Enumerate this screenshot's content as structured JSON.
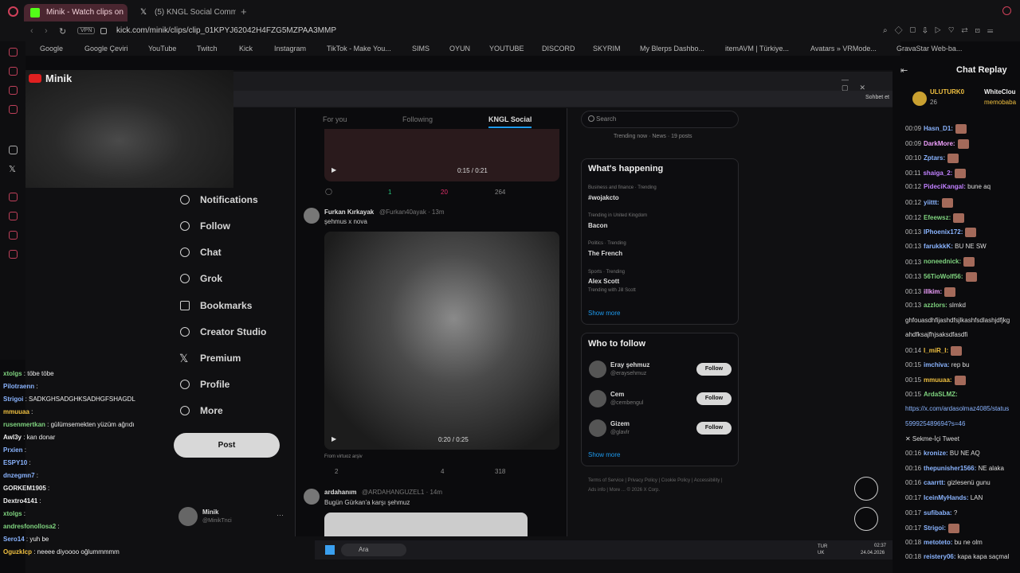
{
  "browser": {
    "tabs": [
      {
        "label": "Minik - Watch clips on"
      },
      {
        "label": "(5) KNGL Social Commun"
      }
    ],
    "vpn": "VPN",
    "url": "kick.com/minik/clips/clip_01KPYJ62042H4FZG5MZPAA3MMP",
    "bookmarks": [
      "Google",
      "Google Çeviri",
      "YouTube",
      "Twitch",
      "Kick",
      "Instagram",
      "TikTok - Make You...",
      "SIMS",
      "OYUN",
      "YOUTUBE",
      "DISCORD",
      "SKYRIM",
      "My Blerps Dashbo...",
      "itemAVM | Türkiye...",
      "Avatars » VRMode...",
      "GravaStar Web-ba..."
    ]
  },
  "stream": {
    "channel": "Minik"
  },
  "x": {
    "tabs": [
      "For you",
      "Following",
      "KNGL Social"
    ],
    "search_placeholder": "Search",
    "nav": [
      "Notifications",
      "Follow",
      "Chat",
      "Grok",
      "Bookmarks",
      "Creator Studio",
      "Premium",
      "Profile",
      "More"
    ],
    "post_button": "Post",
    "account": {
      "name": "Minik",
      "handle": "@MinikTnci"
    },
    "top_video_time": "0:15 / 0:21",
    "top_stats": {
      "retweets": "1",
      "likes": "20",
      "views": "264"
    },
    "tweet1": {
      "name": "Furkan Kırkayak",
      "handle": "@Furkan40ayak · 13m",
      "text": "şehmus x nova",
      "video_time": "0:20 / 0:25",
      "from": "From virtuoz arşiv",
      "replies": "2",
      "likes": "4",
      "views": "318"
    },
    "tweet2": {
      "name": "ardahanım",
      "handle": "@ARDAHANGUZEL1 · 14m",
      "text": "Bugün Gürkan'a karşı şehmuz"
    },
    "trending_now": "Trending now · News · 19 posts",
    "whats_happening": "What's happening",
    "trends": [
      {
        "cat": "Business and finance · Trending",
        "title": "#wojakcto"
      },
      {
        "cat": "Trending in United Kingdom",
        "title": "Bacon"
      },
      {
        "cat": "Politics · Trending",
        "title": "The French"
      },
      {
        "cat": "Sports · Trending",
        "title": "Alex Scott",
        "sub": "Trending with Jill Scott"
      }
    ],
    "show_more": "Show more",
    "who_to_follow": "Who to follow",
    "follow_label": "Follow",
    "suggestions": [
      {
        "name": "Eray şehmuz",
        "handle": "@eraysehmuz"
      },
      {
        "name": "Cem",
        "handle": "@cembengul"
      },
      {
        "name": "Gizem",
        "handle": "@glavlr"
      }
    ],
    "footer": "Terms of Service | Privacy Policy | Cookie Policy | Accessibility | Ads info | More ... © 2026 X Corp.",
    "browser_right": "Sohbet et"
  },
  "taskbar": {
    "search": "Ara",
    "lang": "TUR UK",
    "time": "02:37",
    "date": "24.04.2026"
  },
  "left_chat": [
    {
      "user": "xtolgs",
      "msg": ": töbe töbe",
      "color": "#7fd37f"
    },
    {
      "user": "Pilotraenn",
      "msg": ":",
      "color": "#8ab4ff"
    },
    {
      "user": "Strigoi",
      "msg": ": SADKGHSADGHKSADHGFSHAGDL",
      "color": "#8ab4ff"
    },
    {
      "user": "mmuuaa",
      "msg": ":",
      "color": "#f0c040"
    },
    {
      "user": "rusenmertkan",
      "msg": ": gülümsemekten yüzüm ağrıdı",
      "color": "#7fd37f"
    },
    {
      "user": "Awl3y",
      "msg": ": kan donar",
      "color": "#eeeeee"
    },
    {
      "user": "Prxien",
      "msg": ":",
      "color": "#8ab4ff"
    },
    {
      "user": "ESPY10",
      "msg": ":",
      "color": "#8ab4ff"
    },
    {
      "user": "dnzegmn7",
      "msg": ":",
      "color": "#8ab4ff"
    },
    {
      "user": "GORKEM1905",
      "msg": ":",
      "color": "#eeeeee"
    },
    {
      "user": "Dextro4141",
      "msg": ":",
      "color": "#eeeeee"
    },
    {
      "user": "xtolgs",
      "msg": ":",
      "color": "#7fd37f"
    },
    {
      "user": "andresfonollosa2",
      "msg": ":",
      "color": "#7fd37f"
    },
    {
      "user": "Sero14",
      "msg": ": yuh be",
      "color": "#8ab4ff"
    },
    {
      "user": "Oguzklcp",
      "msg": ": neeee diyoooo oğlummmmm",
      "color": "#f0c040"
    }
  ],
  "chat_replay": {
    "title": "Chat Replay",
    "pinned": [
      {
        "user": "ULUTURK0",
        "sub": "26"
      },
      {
        "user": "WhiteClou",
        "sub": "memobaba"
      }
    ],
    "messages": [
      {
        "t": "00:09",
        "user": "Hasn_D1:",
        "msg": "",
        "color": "#8ab4ff",
        "emo": true
      },
      {
        "t": "00:09",
        "user": "DarkMore:",
        "msg": "",
        "color": "#f0a0ff",
        "emo": true
      },
      {
        "t": "00:10",
        "user": "Zptars:",
        "msg": "",
        "color": "#8ab4ff",
        "emo": true
      },
      {
        "t": "00:11",
        "user": "shaiga_2:",
        "msg": "",
        "color": "#c080ff",
        "emo": true
      },
      {
        "t": "00:12",
        "user": "PideciKangal:",
        "msg": "bune aq",
        "color": "#c080ff",
        "emo": false
      },
      {
        "t": "00:12",
        "user": "yiittt:",
        "msg": "",
        "color": "#8ab4ff",
        "emo": true
      },
      {
        "t": "00:12",
        "user": "Efeewsz:",
        "msg": "",
        "color": "#7fd37f",
        "emo": true
      },
      {
        "t": "00:13",
        "user": "IPhoenix172:",
        "msg": "",
        "color": "#8ab4ff",
        "emo": true
      },
      {
        "t": "00:13",
        "user": "farukkkK:",
        "msg": "BU NE SW",
        "color": "#8ab4ff",
        "emo": false
      },
      {
        "t": "00:13",
        "user": "noneednick:",
        "msg": "",
        "color": "#7fd37f",
        "emo": true
      },
      {
        "t": "00:13",
        "user": "56TioWolf56:",
        "msg": "",
        "color": "#7fd37f",
        "emo": true
      },
      {
        "t": "00:13",
        "user": "illkim:",
        "msg": "",
        "color": "#f0a0ff",
        "emo": true
      },
      {
        "t": "00:13",
        "user": "azzlors:",
        "msg": "slmkd",
        "color": "#7fd37f",
        "emo": false
      },
      {
        "t": "",
        "user": "",
        "msg": "ghfouasdhfijashdfsjlkashfsdlashjdfjkg",
        "color": "#dddddd",
        "emo": false
      },
      {
        "t": "",
        "user": "",
        "msg": "ahdfksajfhjsaksdfasdfi",
        "color": "#dddddd",
        "emo": false
      },
      {
        "t": "00:14",
        "user": "I_miR_I:",
        "msg": "",
        "color": "#f0c040",
        "emo": true
      },
      {
        "t": "00:15",
        "user": "imchiva:",
        "msg": "rep bu",
        "color": "#8ab4ff",
        "emo": false
      },
      {
        "t": "00:15",
        "user": "mmuuaa:",
        "msg": "",
        "color": "#f0c040",
        "emo": true
      },
      {
        "t": "00:15",
        "user": "ArdaSLMZ:",
        "msg": "",
        "color": "#7fd37f",
        "emo": false
      },
      {
        "t": "",
        "user": "",
        "msg": "https://x.com/ardasolmaz4085/status",
        "color": "#8ab4ff",
        "emo": false
      },
      {
        "t": "",
        "user": "",
        "msg": "599925489694?s=46",
        "color": "#8ab4ff",
        "emo": false
      },
      {
        "t": "",
        "user": "",
        "msg": "✕ Sekme-İçi Tweet",
        "color": "#dddddd",
        "emo": false
      },
      {
        "t": "00:16",
        "user": "kronize:",
        "msg": "BU NE AQ",
        "color": "#8ab4ff",
        "emo": false
      },
      {
        "t": "00:16",
        "user": "thepunisher1566:",
        "msg": "NE alaka",
        "color": "#8ab4ff",
        "emo": false
      },
      {
        "t": "00:16",
        "user": "caarrtt:",
        "msg": "gizlesenü gunu",
        "color": "#8ab4ff",
        "emo": false
      },
      {
        "t": "00:17",
        "user": "IceinMyHands:",
        "msg": "LAN",
        "color": "#8ab4ff",
        "emo": false
      },
      {
        "t": "00:17",
        "user": "sufibaba:",
        "msg": "?",
        "color": "#8ab4ff",
        "emo": false
      },
      {
        "t": "00:17",
        "user": "Strigoi:",
        "msg": "",
        "color": "#8ab4ff",
        "emo": true
      },
      {
        "t": "00:18",
        "user": "metoteto:",
        "msg": "bu ne olm",
        "color": "#8ab4ff",
        "emo": false
      },
      {
        "t": "00:18",
        "user": "reistery06:",
        "msg": "kapa kapa saçmal",
        "color": "#8ab4ff",
        "emo": false
      }
    ]
  },
  "colors": {
    "kick_green": "#53fc18",
    "chat_bg": "#0b0b0d",
    "tab_active": "#4a2630"
  }
}
